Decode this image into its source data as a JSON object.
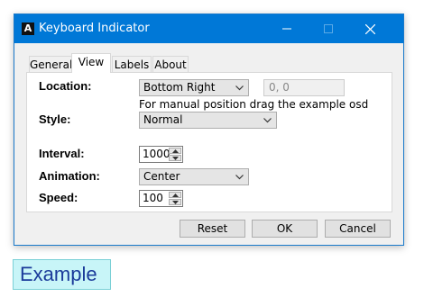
{
  "window": {
    "title": "Keyboard Indicator",
    "app_icon_glyph": "A"
  },
  "tabs": [
    {
      "label": "General",
      "active": false
    },
    {
      "label": "View",
      "active": true
    },
    {
      "label": "Labels",
      "active": false
    },
    {
      "label": "About",
      "active": false
    }
  ],
  "view": {
    "location_label": "Location:",
    "location_value": "Bottom Right",
    "position_value": "0, 0",
    "position_hint": "For manual position drag the example osd",
    "style_label": "Style:",
    "style_value": "Normal",
    "interval_label": "Interval:",
    "interval_value": "1000",
    "animation_label": "Animation:",
    "animation_value": "Center",
    "speed_label": "Speed:",
    "speed_value": "100"
  },
  "buttons": {
    "reset": "Reset",
    "ok": "OK",
    "cancel": "Cancel"
  },
  "example_osd": {
    "text": "Example"
  },
  "colors": {
    "titlebar": "#0078d7",
    "osd_background": "#c8f5f8",
    "osd_text": "#1a3a9a"
  }
}
